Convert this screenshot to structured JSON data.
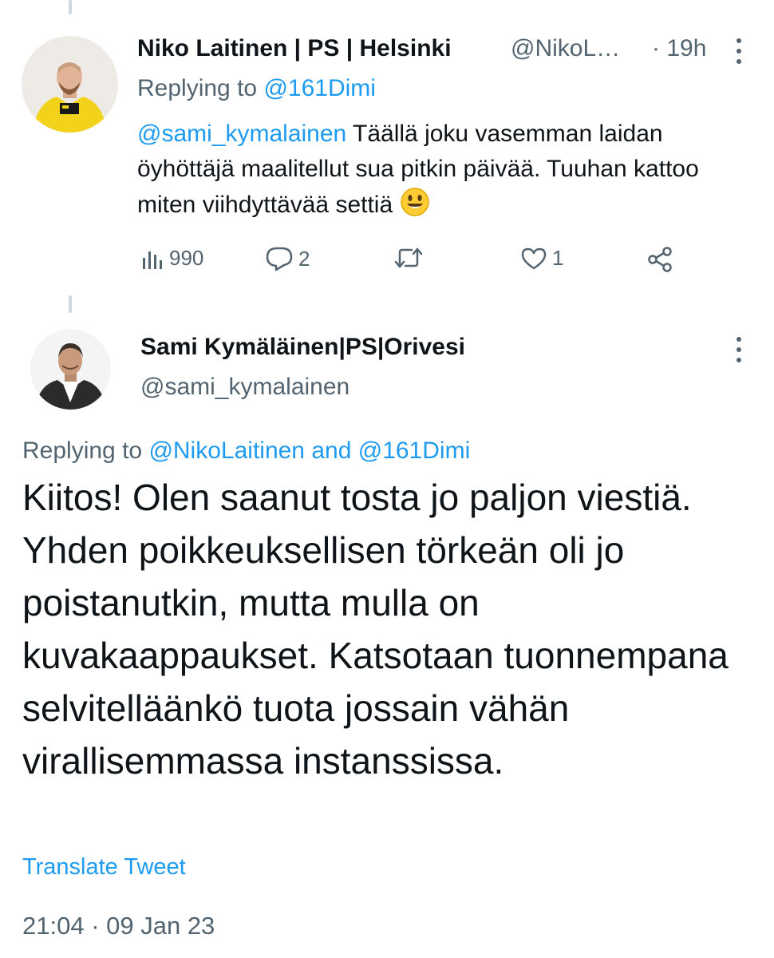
{
  "tweet1": {
    "author_name": "Niko Laitinen | PS | Helsinki",
    "author_handle": "@NikoL…",
    "time": "· 19h",
    "replying_prefix": "Replying to ",
    "replying_handle": "@161Dimi",
    "mention": "@sami_kymalainen",
    "text_after_mention": " Täällä joku vasemman laidan öyhöttäjä maalitellut sua pitkin päivää. Tuuhan kattoo miten viihdyttävää settiä ",
    "views": "990",
    "replies": "2",
    "likes": "1",
    "icons": [
      "views-icon",
      "reply-icon",
      "retweet-icon",
      "like-icon",
      "share-icon",
      "more-icon",
      "smiley-emoji"
    ]
  },
  "tweet2": {
    "author_name": "Sami Kymäläinen|PS|Orivesi",
    "author_handle": "@sami_kymalainen",
    "replying_prefix": "Replying to ",
    "replying_handle_1": "@NikoLaitinen",
    "replying_and": " and ",
    "replying_handle_2": "@161Dimi",
    "text": "Kiitos! Olen saanut tosta jo paljon viestiä. Yhden poikkeuksellisen törkeän oli jo poistanutkin, mutta mulla on kuvakaappaukset. Katsotaan tuonnempana selvitelläänkö tuota jossain vähän virallisemmassa instanssissa.",
    "translate_label": "Translate Tweet",
    "timestamp": "21:04 · 09 Jan 23"
  },
  "colors": {
    "accent": "#1d9bf0",
    "text": "#0f1419",
    "muted": "#536471",
    "thread_line": "#cfd9de"
  }
}
